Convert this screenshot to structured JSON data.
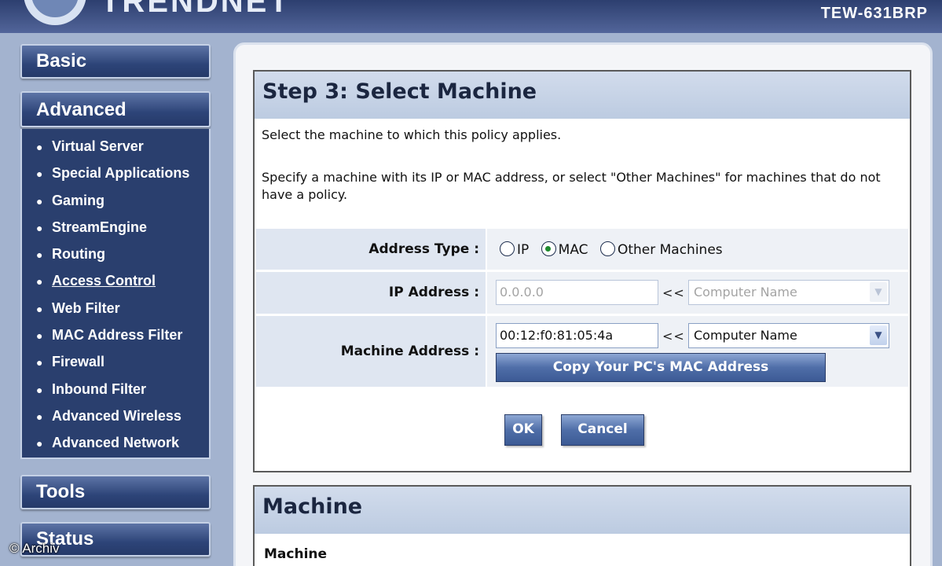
{
  "header": {
    "brand": "TRENDNET",
    "model": "TEW-631BRP"
  },
  "sidebar": {
    "basic": "Basic",
    "advanced": "Advanced",
    "advanced_items": [
      {
        "label": "Virtual Server"
      },
      {
        "label": "Special Applications"
      },
      {
        "label": "Gaming"
      },
      {
        "label": "StreamEngine"
      },
      {
        "label": "Routing"
      },
      {
        "label": "Access Control",
        "active": true
      },
      {
        "label": "Web Filter"
      },
      {
        "label": "MAC Address Filter"
      },
      {
        "label": "Firewall"
      },
      {
        "label": "Inbound Filter"
      },
      {
        "label": "Advanced Wireless"
      },
      {
        "label": "Advanced Network"
      }
    ],
    "tools": "Tools",
    "status": "Status"
  },
  "watermark": "© Archiv",
  "step": {
    "title": "Step 3: Select Machine",
    "intro": "Select the machine to which this policy applies.",
    "desc": "Specify a machine with its IP or MAC address, or select \"Other Machines\" for machines that do not have a policy.",
    "address_type": {
      "label": "Address Type :",
      "options": [
        "IP",
        "MAC",
        "Other Machines"
      ],
      "selected": "MAC"
    },
    "ip_address": {
      "label": "IP Address :",
      "value": "0.0.0.0",
      "arrows": "<<",
      "select": "Computer Name"
    },
    "machine_address": {
      "label": "Machine Address :",
      "value": "00:12:f0:81:05:4a",
      "arrows": "<<",
      "select": "Computer Name",
      "copy_button": "Copy Your PC's MAC Address"
    },
    "ok": "OK",
    "cancel": "Cancel"
  },
  "machine_panel": {
    "title": "Machine",
    "subheading": "Machine"
  }
}
